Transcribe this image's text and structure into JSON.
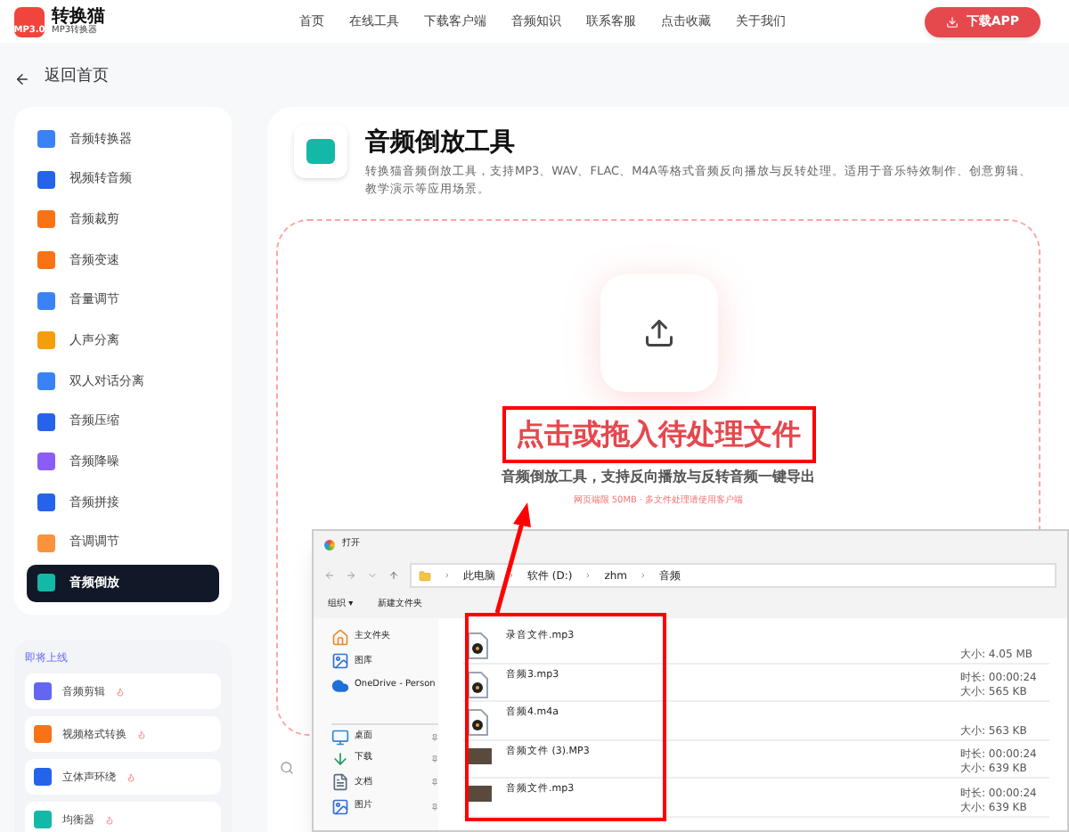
{
  "header": {
    "logo_title": "转换猫",
    "logo_subtitle": "MP3转换器",
    "logo_badge": "MP3.0",
    "nav": [
      "首页",
      "在线工具",
      "下载客户端",
      "音频知识",
      "联系客服",
      "点击收藏",
      "关于我们"
    ],
    "download_button": "下载APP"
  },
  "back_link": "返回首页",
  "sidebar": {
    "items": [
      {
        "label": "音频转换器",
        "selected": false
      },
      {
        "label": "视频转音频",
        "selected": false
      },
      {
        "label": "音频裁剪",
        "selected": false
      },
      {
        "label": "音频变速",
        "selected": false
      },
      {
        "label": "音量调节",
        "selected": false
      },
      {
        "label": "人声分离",
        "selected": false
      },
      {
        "label": "双人对话分离",
        "selected": false
      },
      {
        "label": "音频压缩",
        "selected": false
      },
      {
        "label": "音频降噪",
        "selected": false
      },
      {
        "label": "音频拼接",
        "selected": false
      },
      {
        "label": "音调调节",
        "selected": false
      },
      {
        "label": "音频倒放",
        "selected": true
      }
    ]
  },
  "coming_soon": {
    "title": "即将上线",
    "items": [
      "音频剪辑",
      "视频格式转换",
      "立体声环绕",
      "均衡器"
    ]
  },
  "tool": {
    "title": "音频倒放工具",
    "description": "转换猫音频倒放工具，支持MP3、WAV、FLAC、M4A等格式音频反向播放与反转处理。适用于音乐特效制作、创意剪辑、教学演示等应用场景。"
  },
  "upload": {
    "heading": "点击或拖入待处理文件",
    "subtitle": "音频倒放工具，支持反向播放与反转音频一键导出",
    "note": "网页端限 50MB · 多文件处理请使用客户端"
  },
  "file_dialog": {
    "title": "打开",
    "breadcrumbs": [
      "此电脑",
      "软件 (D:)",
      "zhm",
      "音频"
    ],
    "toolbar": [
      "组织 ▾",
      "新建文件夹"
    ],
    "nav_items": [
      {
        "label": "主文件夹",
        "kind": "home"
      },
      {
        "label": "图库",
        "kind": "gallery"
      },
      {
        "label": "OneDrive - Person",
        "kind": "cloud"
      },
      {
        "label": "桌面",
        "kind": "desktop"
      },
      {
        "label": "下载",
        "kind": "download"
      },
      {
        "label": "文档",
        "kind": "document"
      },
      {
        "label": "图片",
        "kind": "picture"
      }
    ],
    "files": [
      {
        "name": "录音文件.mp3",
        "kind": "audio",
        "details": [
          "大小: 4.05 MB"
        ]
      },
      {
        "name": "音频3.mp3",
        "kind": "audio",
        "details": [
          "时长: 00:00:24",
          "大小: 565 KB"
        ]
      },
      {
        "name": "音频4.m4a",
        "kind": "audio",
        "details": [
          "大小: 563 KB"
        ]
      },
      {
        "name": "音频文件 (3).MP3",
        "kind": "video",
        "details": [
          "时长: 00:00:24",
          "大小: 639 KB"
        ]
      },
      {
        "name": "音频文件.mp3",
        "kind": "video",
        "details": [
          "时长: 00:00:24",
          "大小: 639 KB"
        ]
      }
    ]
  }
}
